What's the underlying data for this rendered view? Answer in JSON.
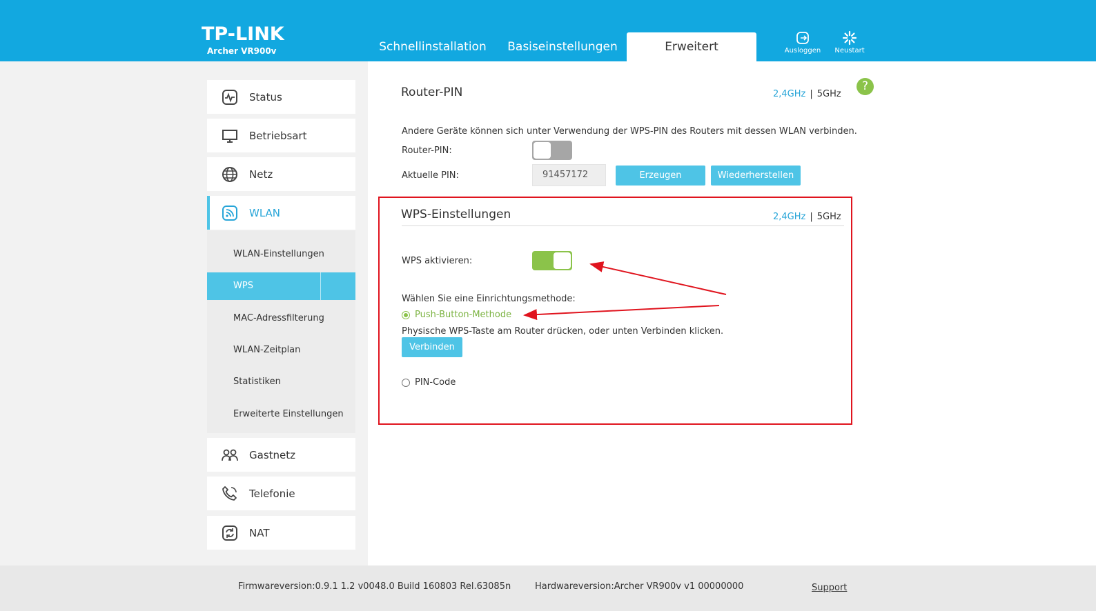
{
  "header": {
    "brand": "TP-LINK",
    "model": "Archer VR900v",
    "tabs": [
      {
        "label": "Schnellinstallation"
      },
      {
        "label": "Basiseinstellungen"
      },
      {
        "label": "Erweitert"
      }
    ],
    "logout_label": "Ausloggen",
    "restart_label": "Neustart"
  },
  "sidebar": {
    "items": [
      {
        "label": "Status",
        "icon": "status-icon"
      },
      {
        "label": "Betriebsart",
        "icon": "monitor-icon"
      },
      {
        "label": "Netz",
        "icon": "globe-icon"
      },
      {
        "label": "WLAN",
        "icon": "wifi-icon"
      },
      {
        "label": "Gastnetz",
        "icon": "guests-icon"
      },
      {
        "label": "Telefonie",
        "icon": "phone-icon"
      },
      {
        "label": "NAT",
        "icon": "nat-icon"
      }
    ],
    "wlan_sub": [
      {
        "label": "WLAN-Einstellungen"
      },
      {
        "label": "WPS"
      },
      {
        "label": "MAC-Adressfilterung"
      },
      {
        "label": "WLAN-Zeitplan"
      },
      {
        "label": "Statistiken"
      },
      {
        "label": "Erweiterte Einstellungen"
      }
    ]
  },
  "router_pin": {
    "title": "Router-PIN",
    "band_24": "2,4GHz",
    "band_sep": "|",
    "band_5": "5GHz",
    "description": "Andere Geräte können sich unter Verwendung der WPS-PIN des Routers mit dessen WLAN verbinden.",
    "toggle_label": "Router-PIN:",
    "toggle_on": false,
    "pin_label": "Aktuelle PIN:",
    "pin_value": "91457172",
    "generate_label": "Erzeugen",
    "restore_label": "Wiederherstellen"
  },
  "wps": {
    "title": "WPS-Einstellungen",
    "band_24": "2,4GHz",
    "band_sep": "|",
    "band_5": "5GHz",
    "enable_label": "WPS aktivieren:",
    "enable_on": true,
    "method_label": "Wählen Sie eine Einrichtungsmethode:",
    "push_button_label": "Push-Button-Methode",
    "push_button_hint": "Physische WPS-Taste am Router drücken, oder unten Verbinden klicken.",
    "connect_label": "Verbinden",
    "pin_code_label": "PIN-Code"
  },
  "help_label": "?",
  "footer": {
    "firmware": "Firmwareversion:0.9.1 1.2 v0048.0 Build 160803 Rel.63085n",
    "hardware": "Hardwareversion:Archer VR900v v1 00000000",
    "support": "Support"
  },
  "colors": {
    "header_bg": "#12a8e0",
    "accent": "#4ec4e6",
    "toggle_on": "#8bc34a",
    "annotation": "#e0141e"
  }
}
